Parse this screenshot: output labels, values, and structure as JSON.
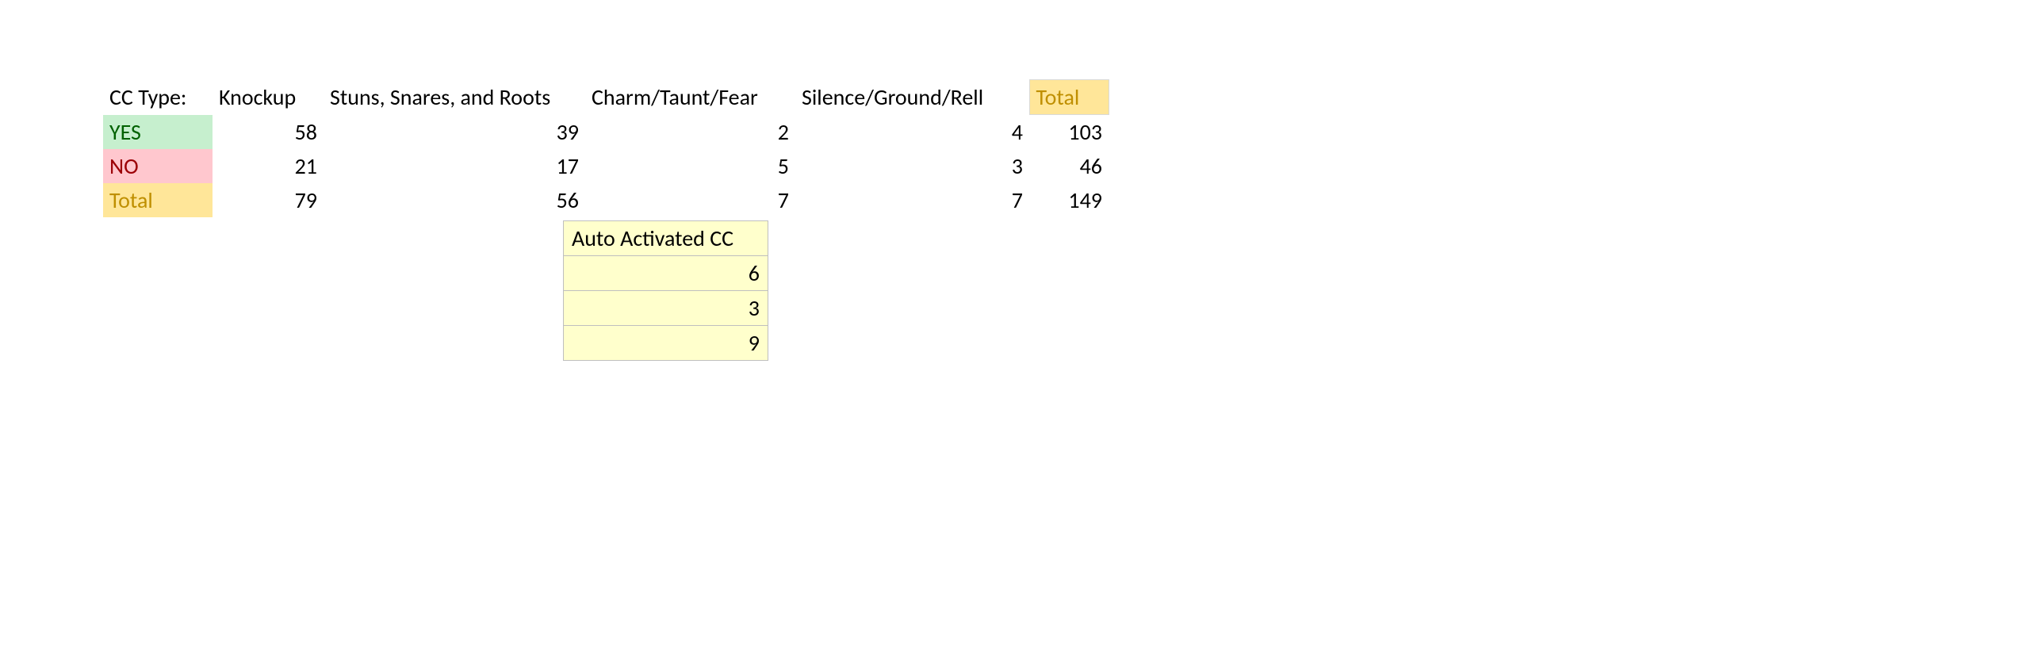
{
  "main": {
    "header": {
      "label": "CC Type:",
      "knockup": "Knockup",
      "stuns": "Stuns, Snares, and Roots",
      "charm": "Charm/Taunt/Fear",
      "silence": "Silence/Ground/Rell",
      "total": "Total"
    },
    "yes": {
      "label": "YES",
      "knockup": "58",
      "stuns": "39",
      "charm": "2",
      "silence": "4",
      "total": "103"
    },
    "no": {
      "label": "NO",
      "knockup": "21",
      "stuns": "17",
      "charm": "5",
      "silence": "3",
      "total": "46"
    },
    "total": {
      "label": "Total",
      "knockup": "79",
      "stuns": "56",
      "charm": "7",
      "silence": "7",
      "total": "149"
    }
  },
  "auto": {
    "header": "Auto Activated CC",
    "r1": "6",
    "r2": "3",
    "r3": "9"
  }
}
